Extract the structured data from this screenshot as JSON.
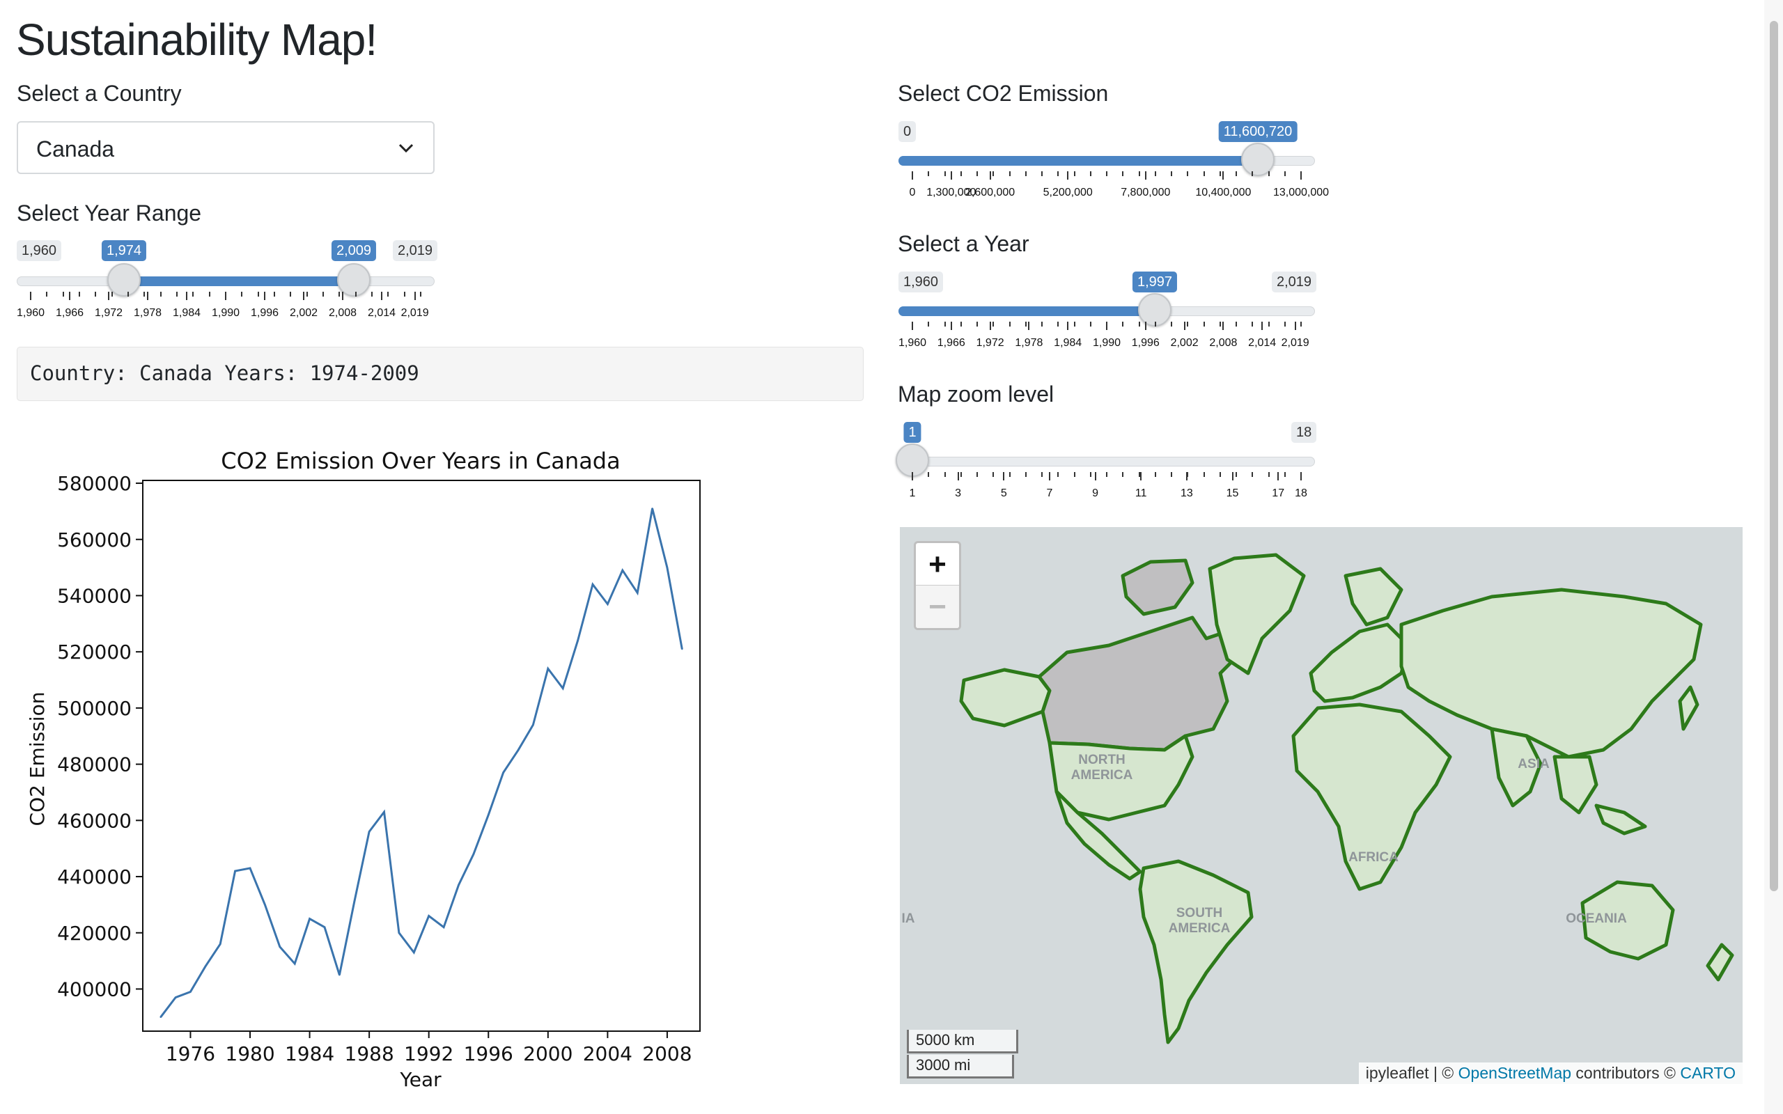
{
  "page": {
    "title": "Sustainability Map!"
  },
  "country": {
    "label": "Select a Country",
    "value": "Canada"
  },
  "year_range": {
    "label": "Select Year Range",
    "min": "1,960",
    "max": "2,019",
    "from": "1,974",
    "to": "2,009",
    "ticks": [
      "1,960",
      "1,966",
      "1,972",
      "1,978",
      "1,984",
      "1,990",
      "1,996",
      "2,002",
      "2,008",
      "2,014",
      "2,019"
    ]
  },
  "output": {
    "text": "Country: Canada Years: 1974-2009"
  },
  "co2": {
    "label": "Select CO2 Emission",
    "min": "0",
    "value": "11,600,720",
    "ticks": [
      "0",
      "1,300,000",
      "2,600,000",
      "5,200,000",
      "7,800,000",
      "10,400,000",
      "13,000,000"
    ]
  },
  "year": {
    "label": "Select a Year",
    "min": "1,960",
    "max": "2,019",
    "value": "1,997",
    "ticks": [
      "1,960",
      "1,966",
      "1,972",
      "1,978",
      "1,984",
      "1,990",
      "1,996",
      "2,002",
      "2,008",
      "2,014",
      "2,019"
    ]
  },
  "zoom": {
    "label": "Map zoom level",
    "value": "1",
    "max": "18",
    "ticks": [
      "1",
      "3",
      "5",
      "7",
      "9",
      "11",
      "13",
      "15",
      "17",
      "18"
    ]
  },
  "map": {
    "zoom_in": "+",
    "zoom_out": "−",
    "scale_km": "5000 km",
    "scale_mi": "3000 mi",
    "attribution_prefix": "ipyleaflet | © ",
    "attribution_osm": "OpenStreetMap",
    "attribution_mid": " contributors © ",
    "attribution_carto": "CARTO",
    "labels": [
      "NORTH",
      "AMERICA",
      "SOUTH",
      "AMERICA",
      "ASIA",
      "AFRICA",
      "OCEANIA",
      "IA"
    ],
    "colors": {
      "ocean": "#d4dadc",
      "land": "#d6e6cf",
      "highlight": "#c0bfc1",
      "border": "#2d7a1a"
    }
  },
  "chart_data": {
    "type": "line",
    "title": "CO2 Emission Over Years in Canada",
    "xlabel": "Year",
    "ylabel": "CO2 Emission",
    "xlim": [
      1972.8,
      2010.2
    ],
    "ylim": [
      385000,
      581000
    ],
    "xticks": [
      1976,
      1980,
      1984,
      1988,
      1992,
      1996,
      2000,
      2004,
      2008
    ],
    "yticks": [
      400000,
      420000,
      440000,
      460000,
      480000,
      500000,
      520000,
      540000,
      560000,
      580000
    ],
    "color": "#3a74ad",
    "series": [
      {
        "x": [
          1974,
          1975,
          1976,
          1977,
          1978,
          1979,
          1980,
          1981,
          1982,
          1983,
          1984,
          1985,
          1986,
          1987,
          1988,
          1989,
          1990,
          1991,
          1992,
          1993,
          1994,
          1995,
          1996,
          1997,
          1998,
          1999,
          2000,
          2001,
          2002,
          2003,
          2004,
          2005,
          2006,
          2007,
          2008,
          2009
        ],
        "values": [
          390000,
          397000,
          399000,
          408000,
          416000,
          442000,
          443000,
          430000,
          415000,
          409000,
          425000,
          422000,
          405000,
          431000,
          456000,
          463000,
          420000,
          413000,
          426000,
          422000,
          437000,
          448000,
          462000,
          477000,
          485000,
          494000,
          514000,
          507000,
          524000,
          544000,
          537000,
          549000,
          541000,
          571000,
          550000,
          521000
        ]
      }
    ]
  }
}
